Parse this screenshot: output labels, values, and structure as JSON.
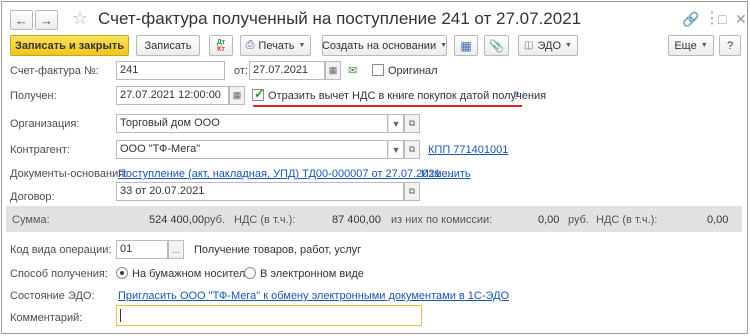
{
  "window": {
    "title": "Счет-фактура полученный на поступление 241 от 27.07.2021"
  },
  "toolbar": {
    "save_close": "Записать и закрыть",
    "save": "Записать",
    "print": "Печать",
    "create_based": "Создать на основании",
    "edo": "ЭДО",
    "more": "Еще",
    "help": "?",
    "dtkt_top": "Дт",
    "dtkt_bottom": "Кт"
  },
  "form": {
    "invoice_label": "Счет-фактура №:",
    "invoice_number": "241",
    "from_label": "от:",
    "invoice_date": "27.07.2021",
    "original_label": "Оригинал",
    "received_label": "Получен:",
    "received_datetime": "27.07.2021 12:00:00",
    "vat_checkbox_label": "Отразить вычет НДС в книге покупок датой получения",
    "vat_help": "?",
    "organization_label": "Организация:",
    "organization_value": "Торговый дом ООО",
    "counterparty_label": "Контрагент:",
    "counterparty_value": "ООО \"ТФ-Мега\"",
    "kpp_link": "КПП 771401001",
    "basis_label": "Документы-основания:",
    "basis_link": "Поступление (акт, накладная, УПД) ТД00-000007 от 27.07.2021 ...",
    "change_link": "Изменить",
    "contract_label": "Договор:",
    "contract_value": "33 от 20.07.2021"
  },
  "summary": {
    "sum_label": "Сумма:",
    "sum_value": "524 400,00",
    "currency1": "руб.",
    "vat_label": "НДС (в т.ч.):",
    "vat_value": "87 400,00",
    "commission_label": "из них по комиссии:",
    "commission_value": "0,00",
    "currency2": "руб.",
    "vat2_label": "НДС (в т.ч.):",
    "vat2_value": "0,00"
  },
  "bottom": {
    "op_code_label": "Код вида операции:",
    "op_code_value": "01",
    "op_code_desc": "Получение товаров, работ, услуг",
    "method_label": "Способ получения:",
    "method_paper": "На бумажном носителе",
    "method_electronic": "В электронном виде",
    "edo_label": "Состояние ЭДО:",
    "edo_link": "Пригласить ООО \"ТФ-Мега\" к обмену электронными документами в 1С-ЭДО",
    "comment_label": "Комментарий:",
    "comment_value": ""
  },
  "colors": {
    "accent_yellow": "#f0c61b",
    "link_blue": "#1a56b0",
    "underline_red": "#e0262a",
    "check_green": "#2e9a3a"
  }
}
